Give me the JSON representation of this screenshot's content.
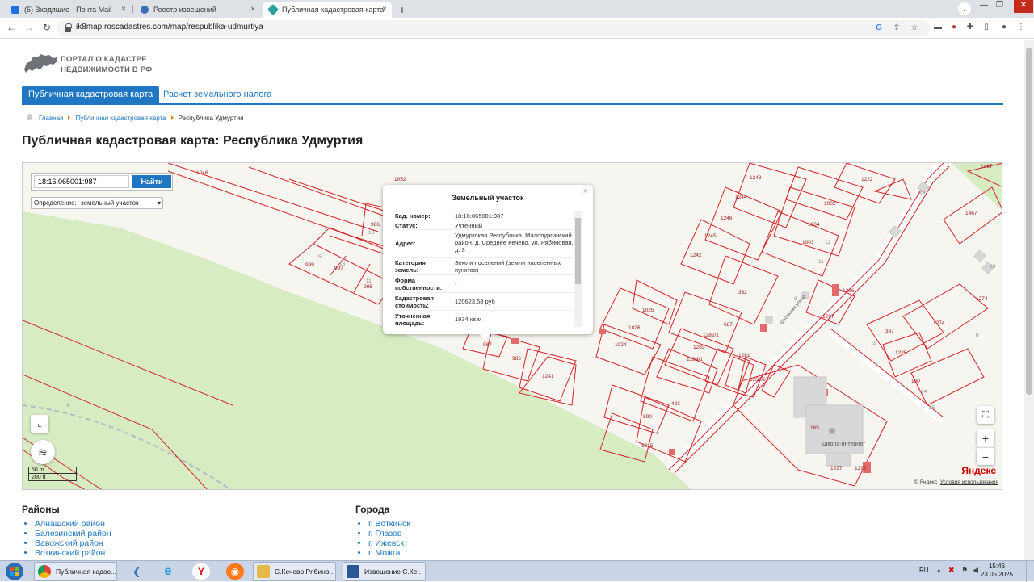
{
  "browser": {
    "tabs": [
      {
        "title": "(5) Входящие - Почта Mail",
        "close": "×",
        "icon_color": "#1a73e8"
      },
      {
        "title": "Реестр извещений",
        "close": "×",
        "icon_color": "#3b6fb6"
      },
      {
        "title": "Публичная кадастровая карта: ",
        "close": "×",
        "icon_color": "#2aa0a0"
      }
    ],
    "new_tab": "+",
    "url": "ik8map.roscadastres.com/map/respublika-udmurtiya",
    "nav": {
      "back": "←",
      "forward": "→",
      "reload": "↻"
    },
    "tab_search": "⌄"
  },
  "site": {
    "logo_line1": "ПОРТАЛ О КАДАСТРЕ",
    "logo_line2": "НЕДВИЖИМОСТИ В РФ",
    "nav_active": "Публичная кадастровая карта",
    "nav_tax": "Расчет земельного налога",
    "breadcrumb": {
      "home": "Главная",
      "map": "Публичная кадастровая карта",
      "current": "Республика Удмуртия"
    },
    "title": "Публичная кадастровая карта: Республика Удмуртия"
  },
  "map": {
    "search_value": "18:16:065001:987",
    "find_label": "Найти",
    "definition_label": "Определение:",
    "definition_value": "земельный участок",
    "zoom_in": "+",
    "zoom_out": "−",
    "fullscreen": "⛶",
    "scale_m": "50 m",
    "scale_ft": "200 ft",
    "yandex_logo": "Яндекс",
    "yandex_copy": "© Яндекс",
    "yandex_terms": "Условия использования",
    "road_label": "Школьная улица",
    "school_label": "Школа-интернат",
    "parcels": [
      "1046",
      "1052",
      "986",
      "999",
      "997",
      "995",
      "15",
      "13",
      "11",
      "16",
      "987",
      "985",
      "1241",
      "1248",
      "1244",
      "1246",
      "1245",
      "1242",
      "1002",
      "1004",
      "1003",
      "332",
      "687",
      "1025",
      "1026",
      "1024",
      "1282/1",
      "1283",
      "1284/1",
      "1281",
      "1282/2",
      "1297",
      "483",
      "890",
      "1015",
      "165",
      "1296",
      "1297",
      "387",
      "1274",
      "1225",
      "100",
      "1467",
      "1222",
      "1467",
      "6",
      "24",
      "20",
      "8",
      "9",
      "12",
      "11",
      "19",
      "24",
      "25",
      "1274",
      "1292"
    ],
    "popup": {
      "title": "Земельный участок",
      "close": "×",
      "rows": [
        {
          "label": "Кад. номер:",
          "value": "18:16:065001:987"
        },
        {
          "label": "Статус:",
          "value": "Учтенный"
        },
        {
          "label": "Адрес:",
          "value": "Удмуртская Республика, Малопургинский район, д. Среднее Кечево, ул. Рябиновая, д. 3"
        },
        {
          "label": "Категория земель:",
          "value": "Земли поселений (земли населенных пунктов)"
        },
        {
          "label": "Форма собственности:",
          "value": "-"
        },
        {
          "label": "Кадастровая стоимость:",
          "value": "120623.58 руб"
        },
        {
          "label": "Уточненная площадь:",
          "value": "1934 кв.м"
        }
      ]
    }
  },
  "lists": {
    "districts_title": "Районы",
    "districts": [
      "Алнашский район",
      "Балезинский район",
      "Вавожский район",
      "Воткинский район"
    ],
    "cities_title": "Города",
    "cities": [
      "г. Воткинск",
      "г. Глазов",
      "г. Ижевск",
      "г. Можга"
    ]
  },
  "taskbar": {
    "tasks": [
      {
        "title": "Публичная кадас...",
        "icon_color": "#dd4b39"
      },
      {
        "title": "С.Кечево Рябино...",
        "icon_color": "#e6b84a"
      },
      {
        "title": "Извещение С.Ке...",
        "icon_color": "#2b5797"
      }
    ],
    "lang": "RU",
    "time": "15:46",
    "date": "23.05.2025"
  },
  "colors": {
    "accent": "#1f76c2",
    "parcel": "#d0242a",
    "forest": "#d8ecc4"
  }
}
